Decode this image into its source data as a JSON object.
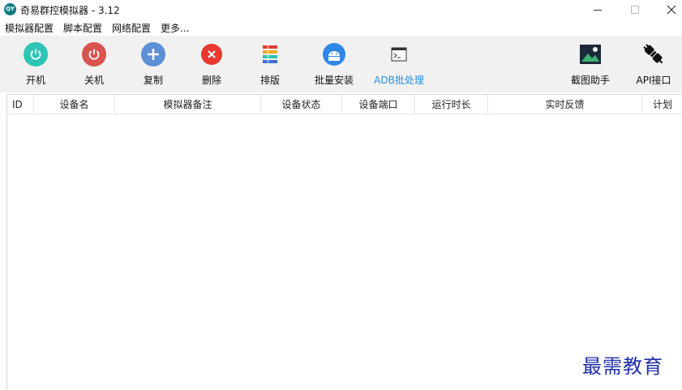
{
  "window": {
    "title": "奇易群控模拟器 - 3.12",
    "logo_text": "QY"
  },
  "menu": [
    "模拟器配置",
    "脚本配置",
    "网络配置",
    "更多..."
  ],
  "toolbar": {
    "power_on": "开机",
    "power_off": "关机",
    "copy": "复制",
    "delete": "删除",
    "arrange": "排版",
    "batch_install": "批量安装",
    "adb_batch": "ADB批处理",
    "screenshot": "截图助手",
    "api": "API接口"
  },
  "table": {
    "columns": [
      "ID",
      "设备名",
      "模拟器备注",
      "设备状态",
      "设备端口",
      "运行时长",
      "实时反馈",
      "计划"
    ],
    "rows": []
  },
  "watermark": "最需教育",
  "colors": {
    "accent_teal": "#2ec4b6",
    "accent_red": "#d9534f",
    "accent_blue": "#5b8fd6",
    "link_blue": "#2b8fe0",
    "watermark": "#1f2fa8"
  }
}
